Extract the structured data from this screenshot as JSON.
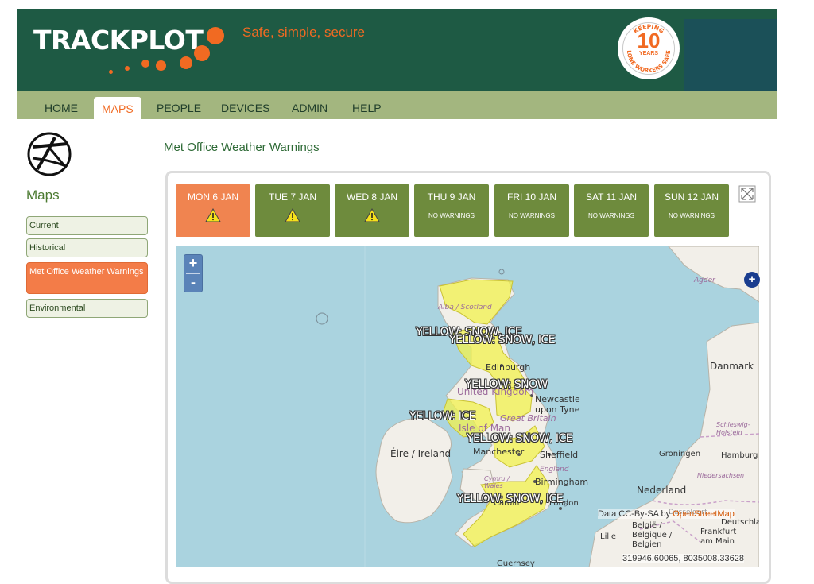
{
  "header": {
    "logo": "TRACKPLOT",
    "tagline": "Safe, simple, secure",
    "badge": {
      "top": "KEEPING",
      "number": "10",
      "years": "YEARS",
      "bottom": "LONE WORKERS SAFE"
    }
  },
  "nav": {
    "items": [
      "HOME",
      "MAPS",
      "PEOPLE",
      "DEVICES",
      "ADMIN",
      "HELP"
    ],
    "active": "MAPS"
  },
  "sidebar": {
    "title": "Maps",
    "items": [
      "Current",
      "Historical",
      "Met Office Weather Warnings",
      "Environmental"
    ],
    "active": "Met Office Weather Warnings"
  },
  "main": {
    "title": "Met Office Weather Warnings",
    "days": [
      {
        "label": "MON 6 JAN",
        "status": "warning"
      },
      {
        "label": "TUE 7 JAN",
        "status": "warning"
      },
      {
        "label": "WED 8 JAN",
        "status": "warning"
      },
      {
        "label": "THU 9 JAN",
        "status": "NO WARNINGS"
      },
      {
        "label": "FRI 10 JAN",
        "status": "NO WARNINGS"
      },
      {
        "label": "SAT 11 JAN",
        "status": "NO WARNINGS"
      },
      {
        "label": "SUN 12 JAN",
        "status": "NO WARNINGS"
      }
    ],
    "active_day": "MON 6 JAN"
  },
  "map": {
    "zoom_in": "+",
    "zoom_out": "-",
    "place_labels": [
      "Alba / Scotland",
      "Edinburgh",
      "United Kingdom",
      "Newcastle upon Tyne",
      "Great Britain",
      "Isle of Man",
      "Éire / Ireland",
      "Manchester",
      "Sheffield",
      "England",
      "Birmingham",
      "Cymru / Wales",
      "Cardiff",
      "London",
      "Danmark",
      "Schleswig-Holstein",
      "Groningen",
      "Hamburg",
      "Nederland",
      "Niedersachsen",
      "België / Belgique / Belgien",
      "Lille",
      "Frankfurt am Main",
      "Agder",
      "Guernsey",
      "Düsseldorf",
      "Deutschland"
    ],
    "warnings": [
      "YELLOW: SNOW, ICE",
      "YELLOW: SNOW, ICE",
      "YELLOW: SNOW",
      "YELLOW: ICE",
      "YELLOW: SNOW, ICE",
      "YELLOW: SNOW, ICE"
    ],
    "attribution": "Data CC-By-SA by",
    "attribution_link": "OpenStreetMap",
    "coordinates": "319946.60065, 8035008.33628",
    "corner_button": "+"
  },
  "colors": {
    "brand_green": "#1e5a44",
    "accent_orange": "#f16a22",
    "nav_green": "#a3b67f",
    "tab_green": "#6e8b3d",
    "tab_active": "#f08450",
    "warning_yellow": "#f2f24c"
  }
}
